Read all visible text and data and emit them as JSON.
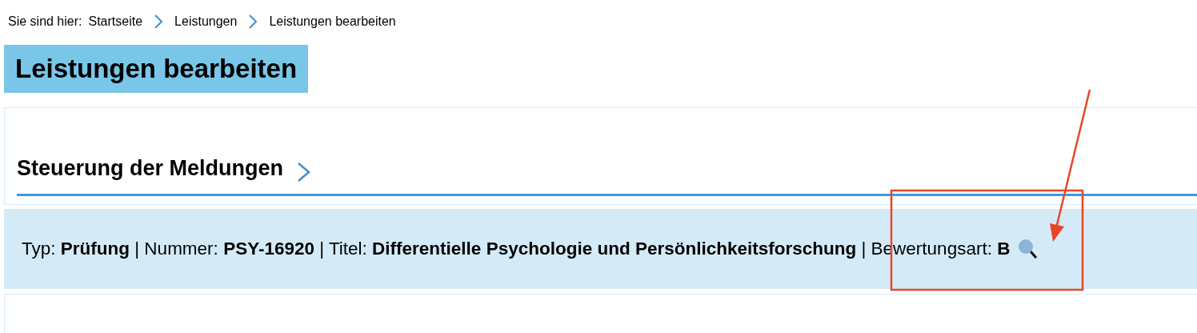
{
  "breadcrumb": {
    "label": "Sie sind hier:",
    "items": [
      {
        "text": "Startseite"
      },
      {
        "text": "Leistungen"
      },
      {
        "text": "Leistungen bearbeiten"
      }
    ]
  },
  "page_title": "Leistungen bearbeiten",
  "section": {
    "heading": "Steuerung der Meldungen"
  },
  "info_bar": {
    "text": "Typ: **Prüfung** | Nummer: **PSY-16920** | Titel: **Differentielle Psychologie und Persönlichkeitsforschung** | Bewertungsart: **B**"
  }
}
